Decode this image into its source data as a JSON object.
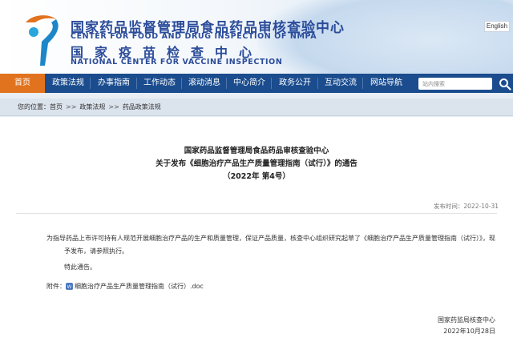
{
  "header": {
    "title_cn": "国家药品监督管理局食品药品审核查验中心",
    "title_en": "CENTER FOR FOOD AND DRUG INSPECTION OF NMPA",
    "subtitle_cn": "国家疫苗检查中心",
    "subtitle_en": "NATIONAL CENTER FOR VACCINE INSPECTION",
    "lang_button": "English"
  },
  "nav": {
    "items": [
      {
        "label": "首页",
        "active": true
      },
      {
        "label": "政策法规"
      },
      {
        "label": "办事指南"
      },
      {
        "label": "工作动态"
      },
      {
        "label": "滚动消息"
      },
      {
        "label": "中心简介"
      },
      {
        "label": "政务公开"
      },
      {
        "label": "互动交流"
      },
      {
        "label": "网站导航"
      }
    ],
    "search_placeholder": "站内搜索",
    "accent": "#e1731f",
    "bar_color": "#1a4c8e"
  },
  "breadcrumb": {
    "prefix": "您的位置：",
    "items": [
      "首页",
      "政策法规",
      "药品政策法规"
    ],
    "separator": ">>"
  },
  "article": {
    "title_line1": "国家药品监督管理局食品药品审核查验中心",
    "title_line2": "关于发布《细胞治疗产品生产质量管理指南（试行）》的通告",
    "title_line3": "（2022年 第4号）",
    "publish_label": "发布时间：2022-10-31",
    "body": "为指导药品上市许可持有人规范开展细胞治疗产品的生产和质量管理，保证产品质量，核查中心组织研究起草了《细胞治疗产品生产质量管理指南（试行）》，现予发布，请参照执行。",
    "notice": "特此通告。",
    "attachment_label": "附件：",
    "attachment_file": "细胞治疗产品生产质量管理指南（试行）.doc",
    "sign_org": "国家药监局核查中心",
    "sign_date": "2022年10月28日"
  }
}
